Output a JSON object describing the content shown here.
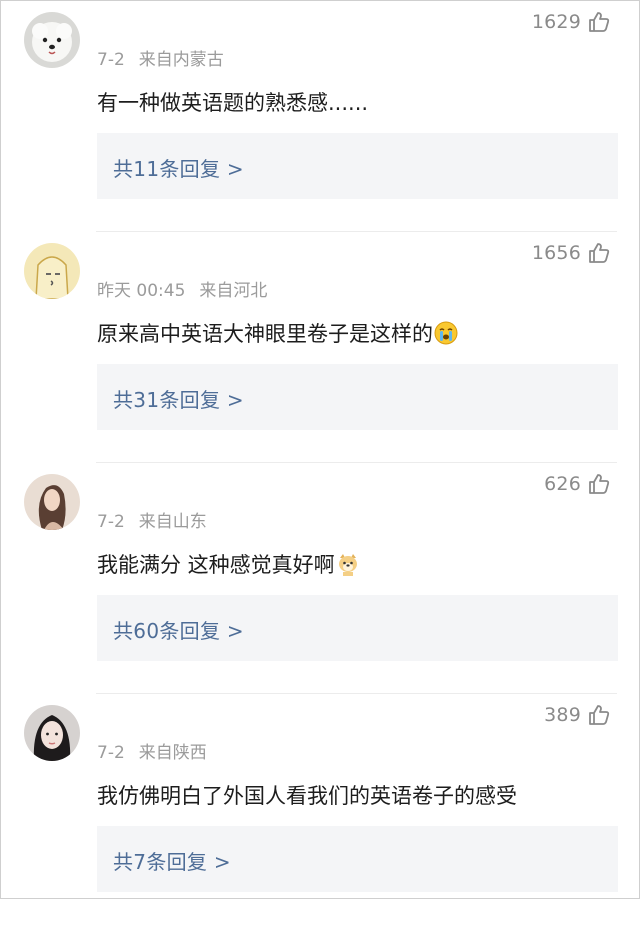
{
  "comments": [
    {
      "avatar": "white-pomeranian-dog",
      "likes": "1629",
      "date": "7-2",
      "location": "来自内蒙古",
      "text": "有一种做英语题的熟悉感......",
      "emoji": "",
      "replies": "共11条回复 >"
    },
    {
      "avatar": "cartoon-face",
      "likes": "1656",
      "date": "昨天 00:45",
      "location": "来自河北",
      "text": "原来高中英语大神眼里卷子是这样的",
      "emoji": "crying-face-emoji",
      "replies": "共31条回复 >"
    },
    {
      "avatar": "woman-portrait",
      "likes": "626",
      "date": "7-2",
      "location": "来自山东",
      "text": "我能满分 这种感觉真好啊",
      "emoji": "doge-emoji",
      "replies": "共60条回复 >"
    },
    {
      "avatar": "girl-portrait",
      "likes": "389",
      "date": "7-2",
      "location": "来自陕西",
      "text": "我仿佛明白了外国人看我们的英语卷子的感受",
      "emoji": "",
      "replies": "共7条回复 >"
    }
  ],
  "colors": {
    "text": "#1d1d1d",
    "meta": "#9b9b9b",
    "like": "#8a8a8a",
    "reply_link": "#4e6d97",
    "reply_bg": "#f4f5f7"
  },
  "icons": {
    "like": "thumbs-up-icon"
  }
}
